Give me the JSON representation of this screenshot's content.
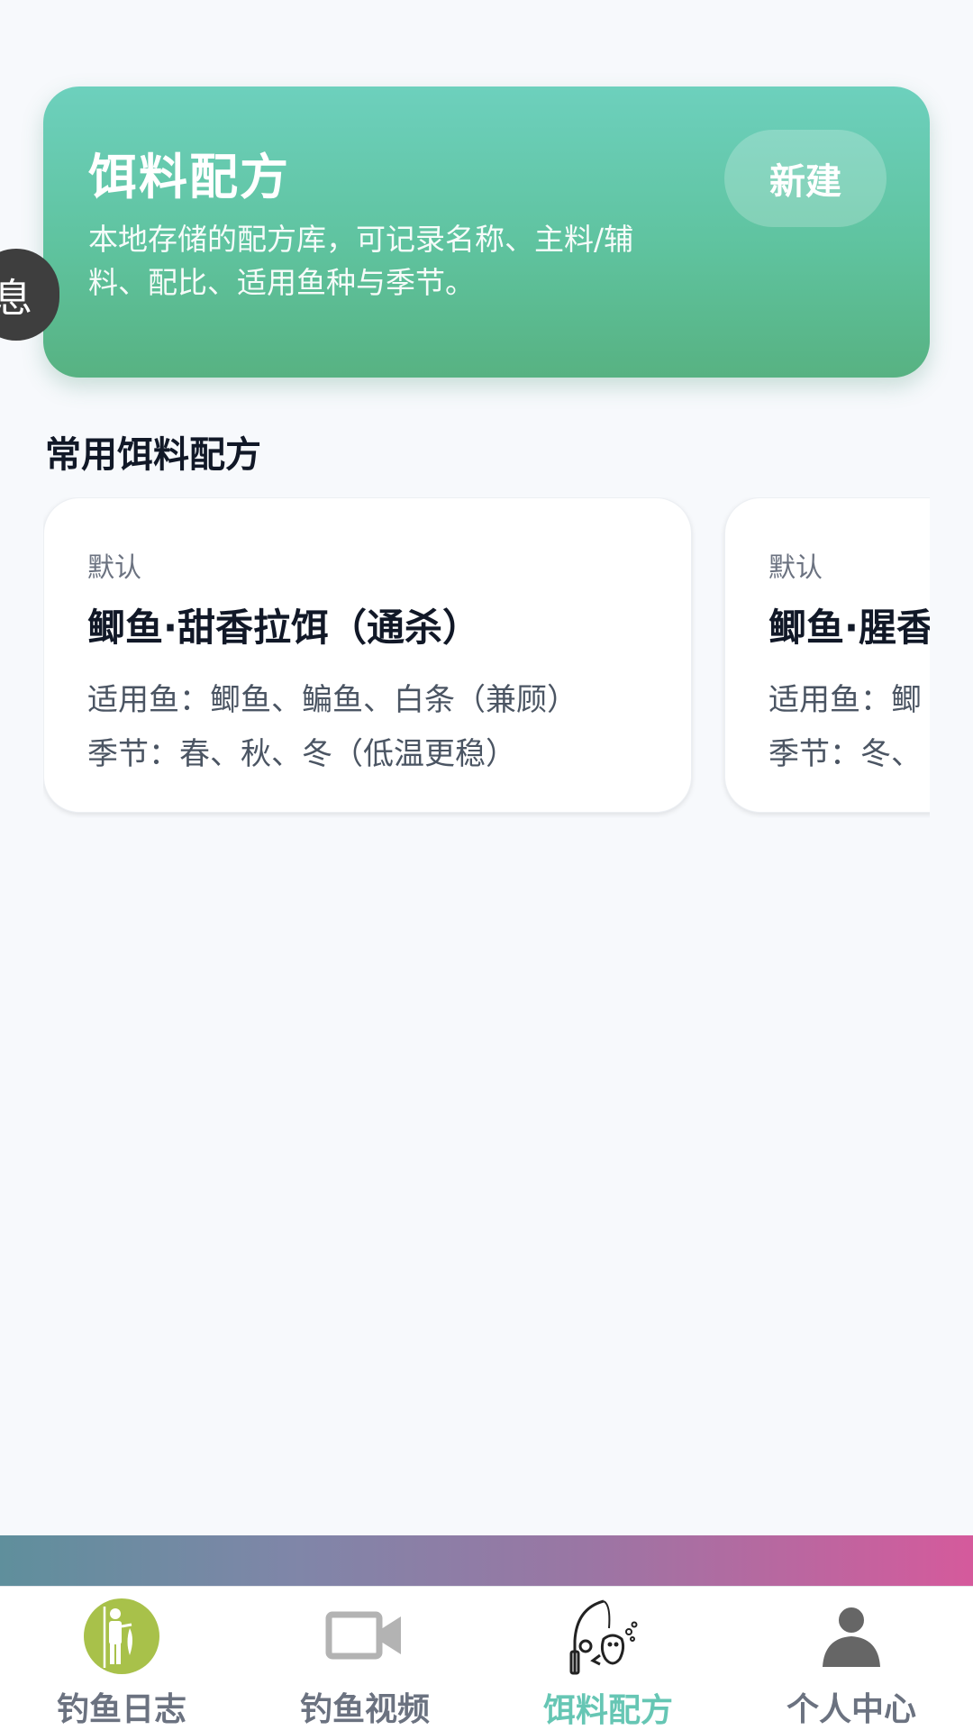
{
  "hero": {
    "title": "饵料配方",
    "description": "本地存储的配方库，可记录名称、主料/辅料、配比、适用鱼种与季节。",
    "new_button": "新建"
  },
  "side_pill": {
    "label": "息"
  },
  "section": {
    "title": "常用饵料配方"
  },
  "recipes": [
    {
      "tag": "默认",
      "name": "鲫鱼·甜香拉饵（通杀）",
      "fish": "适用鱼：鲫鱼、鳊鱼、白条（兼顾）",
      "season": "季节：春、秋、冬（低温更稳）"
    },
    {
      "tag": "默认",
      "name": "鲫鱼·腥香",
      "fish": "适用鱼：鲫",
      "season": "季节：冬、"
    }
  ],
  "tabs": [
    {
      "label": "钓鱼日志",
      "icon": "fisherman-icon",
      "active": false
    },
    {
      "label": "钓鱼视频",
      "icon": "video-camera-icon",
      "active": false
    },
    {
      "label": "饵料配方",
      "icon": "fishing-rod-icon",
      "active": true
    },
    {
      "label": "个人中心",
      "icon": "user-icon",
      "active": false
    }
  ],
  "colors": {
    "accent": "#66c6b4",
    "hero_top": "#6dd0bd",
    "hero_bottom": "#57b282",
    "strip_left": "#5f8f9c",
    "strip_right": "#d55a9c"
  }
}
